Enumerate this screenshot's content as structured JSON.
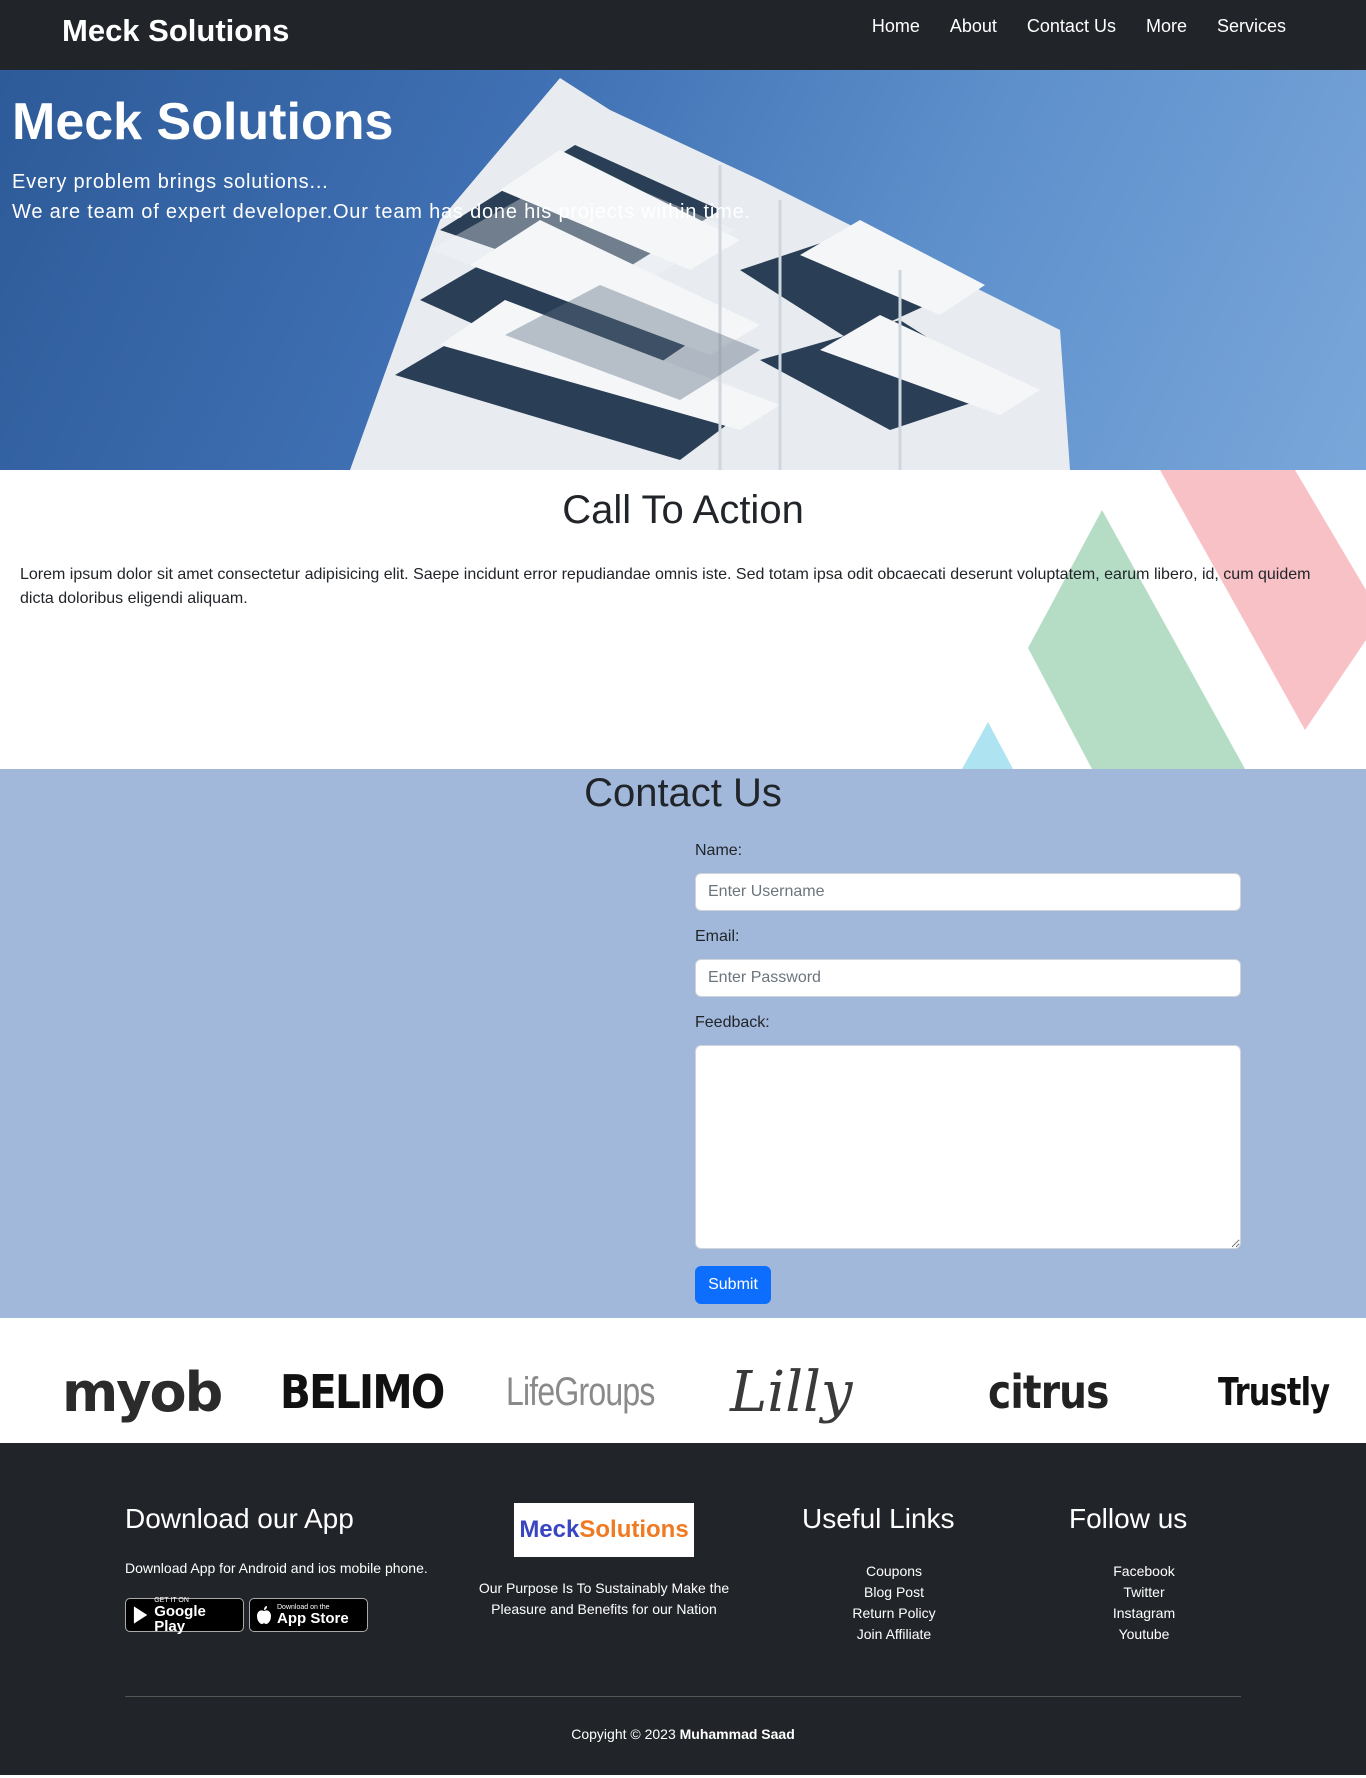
{
  "navbar": {
    "brand": "Meck Solutions",
    "links": [
      "Home",
      "About",
      "Contact Us",
      "More",
      "Services"
    ]
  },
  "hero": {
    "title": "Meck Solutions",
    "line1": "Every problem brings solutions...",
    "line2": "We are team of expert developer.Our team has done his projects within time."
  },
  "cta": {
    "title": "Call To Action",
    "text": "Lorem ipsum dolor sit amet consectetur adipisicing elit. Saepe incidunt error repudiandae omnis iste. Sed totam ipsa odit obcaecati deserunt voluptatem, earum libero, id, cum quidem dicta doloribus eligendi aliquam."
  },
  "contact": {
    "title": "Contact Us",
    "name_label": "Name:",
    "name_placeholder": "Enter Username",
    "email_label": "Email:",
    "email_placeholder": "Enter Password",
    "feedback_label": "Feedback:",
    "submit_label": "Submit"
  },
  "logos": {
    "myob": "myob",
    "belimo": "BELIMO",
    "lifegroups": "LifeGroups",
    "lilly": "Lilly",
    "citrus": "citrus",
    "trustly": "Trustly"
  },
  "footer": {
    "app_heading": "Download our App",
    "app_text": "Download App for Android and ios mobile phone.",
    "google_play_small": "GET IT ON",
    "google_play_big": "Google Play",
    "app_store_small": "Download on the",
    "app_store_big": "App Store",
    "logo_part1": "Meck",
    "logo_part2": "Solutions",
    "purpose": "Our Purpose Is To Sustainably Make the Pleasure and Benefits for our Nation",
    "useful_heading": "Useful Links",
    "useful_links": [
      "Coupons",
      "Blog Post",
      "Return Policy",
      "Join Affiliate"
    ],
    "follow_heading": "Follow us",
    "follow_links": [
      "Facebook",
      "Twitter",
      "Instagram",
      "Youtube"
    ],
    "copyright_prefix": "Copyight © 2023",
    "copyright_name": "Muhammad Saad"
  },
  "colors": {
    "navbar_bg": "#212529",
    "contact_bg": "#a1b8db",
    "submit_bg": "#0d6efd",
    "footer_bg": "#212529"
  }
}
